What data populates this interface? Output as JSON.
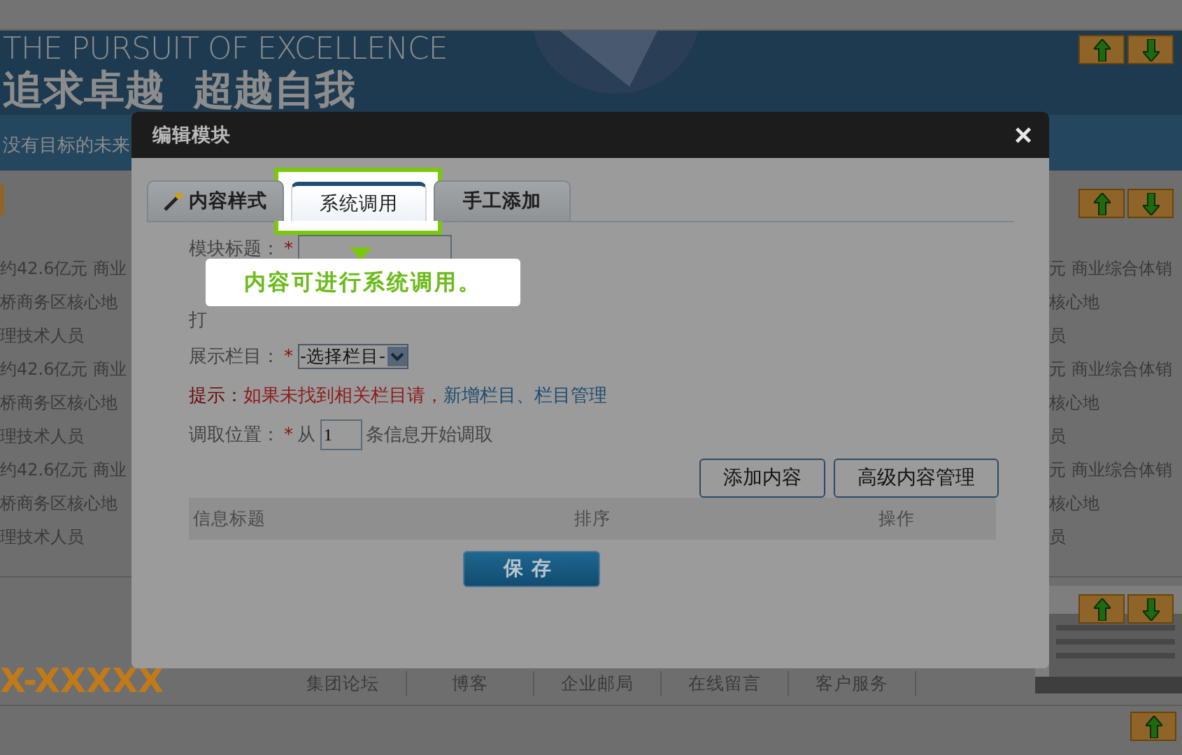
{
  "banner": {
    "headline_en": "THE PURSUIT OF EXCELLENCE",
    "headline_cn": "追求卓越  超越自我",
    "tagline": "没有目标的未来"
  },
  "left_news": [
    "约42.6亿元 商业",
    "桥商务区核心地",
    "理技术人员",
    "约42.6亿元 商业",
    "桥商务区核心地",
    "理技术人员",
    "约42.6亿元 商业",
    "桥商务区核心地",
    "理技术人员"
  ],
  "right_news": [
    "元 商业综合体销",
    "核心地",
    "员",
    "元 商业综合体销",
    "核心地",
    "员",
    "元 商业综合体销",
    "核心地",
    "员"
  ],
  "footer": {
    "phone": "X-XXXXX",
    "links": [
      "集团论坛",
      "博客",
      "企业邮局",
      "在线留言",
      "客户服务"
    ]
  },
  "dialog": {
    "title": "编辑模块",
    "close": "×",
    "tabs": [
      {
        "label": "内容样式",
        "selected": false
      },
      {
        "label": "系统调用",
        "selected": true
      },
      {
        "label": "手工添加",
        "selected": false
      }
    ],
    "tooltip": "内容可进行系统调用。",
    "fields": [
      {
        "kind": "input",
        "label": "模块标题：",
        "mark": "*"
      },
      {
        "kind": "text",
        "label": "打"
      },
      {
        "kind": "select",
        "label": "展示栏目：",
        "mark": "*",
        "value": "-选择栏目-"
      }
    ],
    "hint": [
      {
        "kind": "label",
        "text": "提示："
      },
      {
        "kind": "warning",
        "text": "如果未找到相关栏目请，"
      },
      {
        "kind": "link",
        "text": "新增栏目"
      },
      {
        "kind": "plain",
        "text": "、"
      },
      {
        "kind": "link",
        "text": "栏目管理"
      }
    ],
    "start": {
      "label": "调取位置：",
      "mark": "*",
      "prefix": "从",
      "value": "1",
      "suffix": "条信息开始调取"
    },
    "buttons": [
      "添加内容",
      "高级内容管理"
    ],
    "columns": [
      "信息标题",
      "排序",
      "操作"
    ],
    "save": "保存"
  }
}
